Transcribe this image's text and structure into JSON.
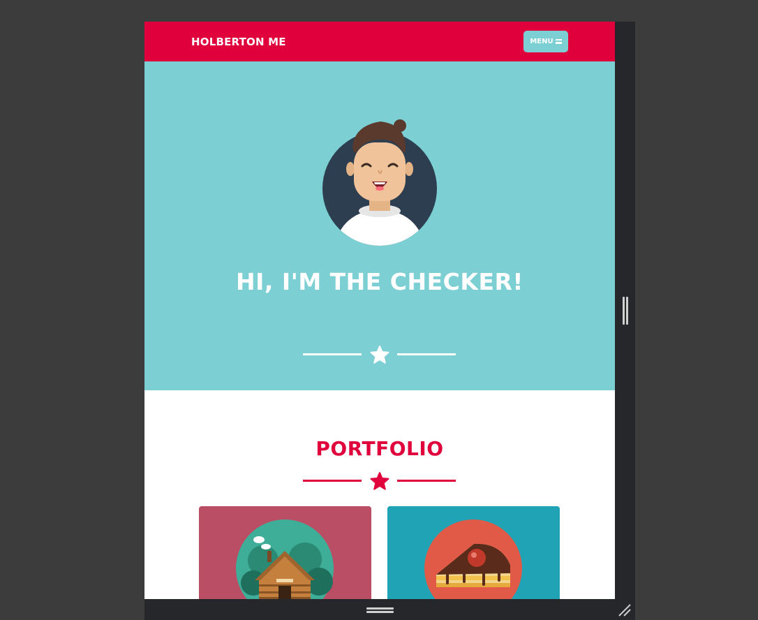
{
  "navbar": {
    "brand": "HOLBERTON ME",
    "menu_label": "MENU",
    "menu_icon": "hamburger-icon"
  },
  "hero": {
    "title": "HI, I'M THE CHECKER!",
    "avatar_icon": "avatar-illustration",
    "divider_icon": "star-icon"
  },
  "portfolio": {
    "title": "PORTFOLIO",
    "divider_icon": "star-icon",
    "items": [
      {
        "icon": "cabin-icon"
      },
      {
        "icon": "cake-icon"
      }
    ]
  },
  "colors": {
    "primary": "#e0003b",
    "hero_bg": "#7ccfd3",
    "card_1": "#b94e65",
    "card_2": "#20a4b5",
    "outer_bg": "#3c3c3c",
    "frame": "#26272b"
  }
}
